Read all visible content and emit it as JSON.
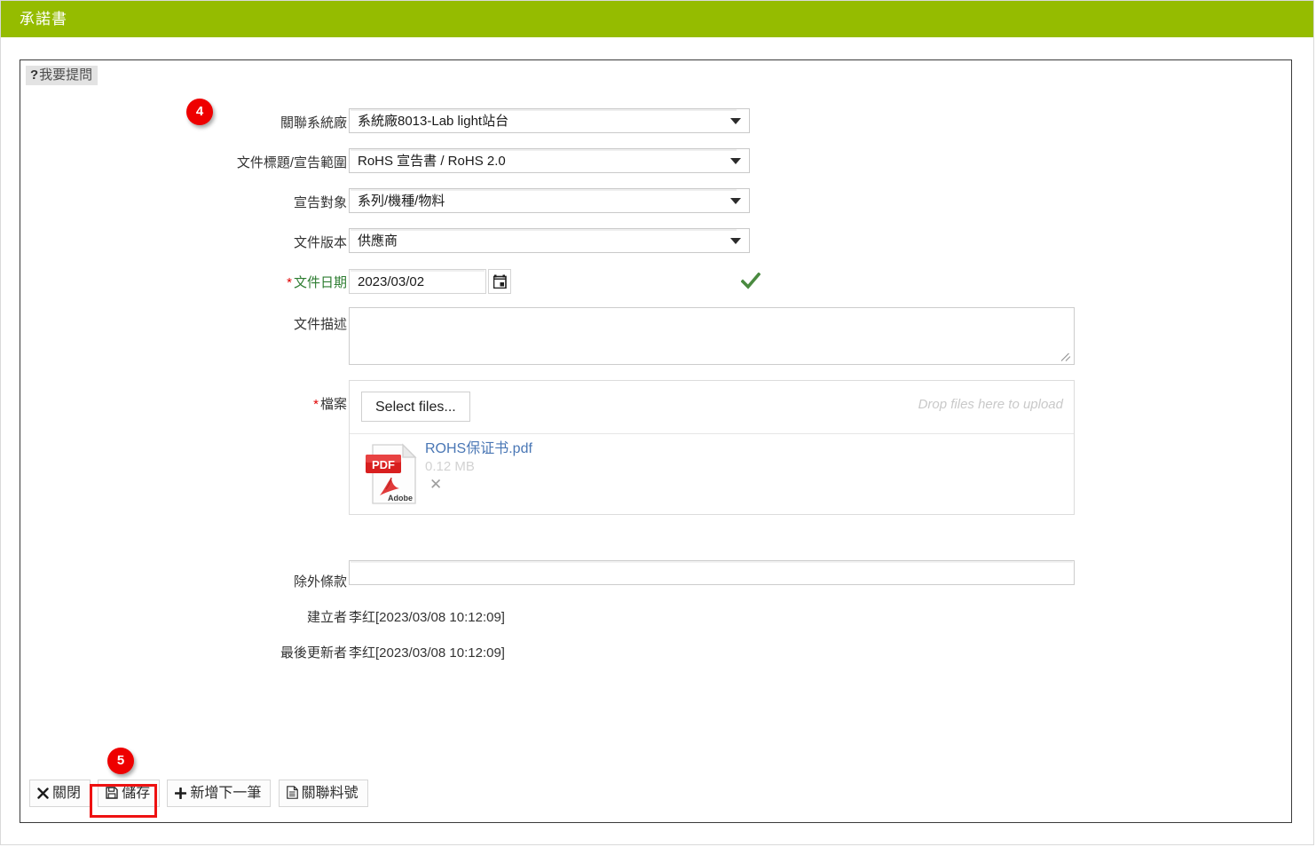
{
  "window": {
    "title": "承諾書",
    "header_color": "#95bc00"
  },
  "tab": {
    "question_mark": "?",
    "label": "我要提問"
  },
  "badges": [
    {
      "number": "4"
    },
    {
      "number": "5"
    }
  ],
  "form": {
    "fields": [
      {
        "label": "關聯系統廠",
        "type": "select",
        "value": "系統廠8013-Lab light站台",
        "required": false
      },
      {
        "label": "文件標題/宣告範圍",
        "type": "select",
        "value": "RoHS 宣告書 / RoHS 2.0",
        "required": false
      },
      {
        "label": "宣告對象",
        "type": "select",
        "value": "系列/機種/物料",
        "required": false
      },
      {
        "label": "文件版本",
        "type": "select",
        "value": "供應商",
        "required": false
      }
    ],
    "date_field": {
      "label": "文件日期",
      "required_mark": "*",
      "value": "2023/03/02",
      "calendar_icon": "calendar-icon",
      "valid_icon": "check-icon",
      "valid_color": "#4a8a40",
      "label_color": "#2e7d32"
    },
    "description_field": {
      "label": "文件描述",
      "value": "",
      "placeholder": ""
    },
    "file_field": {
      "label": "檔案",
      "required_mark": "*",
      "select_files_label": "Select files...",
      "drop_hint": "Drop files here to upload",
      "files": [
        {
          "icon": "pdf-icon",
          "name": "ROHS保证书.pdf",
          "size": "0.12 MB",
          "remove_label": "✕"
        }
      ]
    },
    "exclusion_field": {
      "label": "除外條款",
      "value": "",
      "placeholder": ""
    },
    "creator": {
      "label": "建立者",
      "value": "李红[2023/03/08 10:12:09]"
    },
    "last_updater": {
      "label": "最後更新者",
      "value": "李红[2023/03/08 10:12:09]"
    }
  },
  "buttons": [
    {
      "icon": "close-x-icon",
      "label": "關閉",
      "highlighted": false
    },
    {
      "icon": "save-floppy-icon",
      "label": "儲存",
      "highlighted": true
    },
    {
      "icon": "plus-icon",
      "label": "新增下一筆",
      "highlighted": false
    },
    {
      "icon": "document-icon",
      "label": "關聯料號",
      "highlighted": false
    }
  ]
}
